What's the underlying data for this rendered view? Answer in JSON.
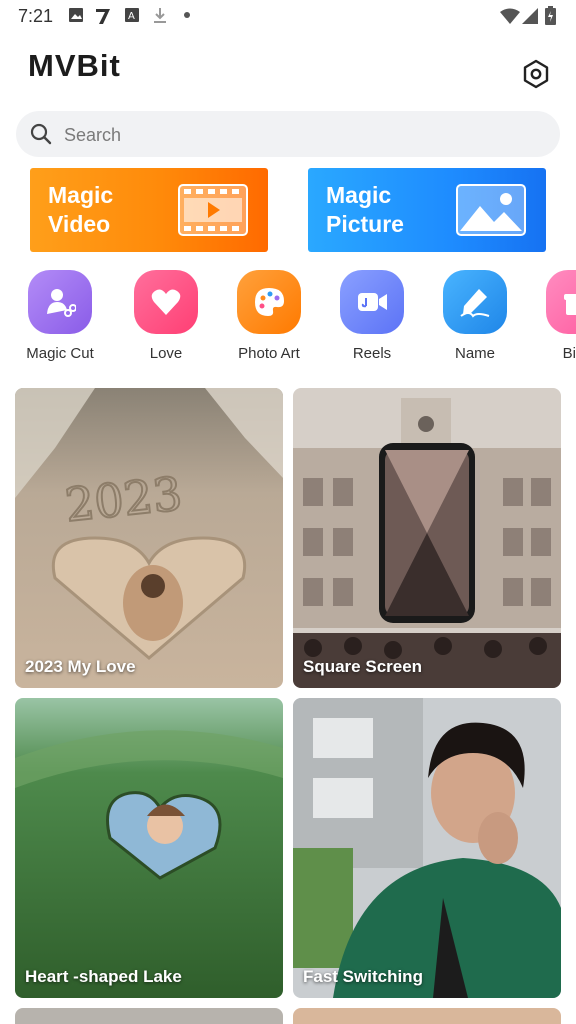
{
  "status_bar": {
    "time": "7:21"
  },
  "header": {
    "logo": "MVBit"
  },
  "search": {
    "placeholder": "Search"
  },
  "banners": [
    {
      "line1": "Magic",
      "line2": "Video"
    },
    {
      "line1": "Magic",
      "line2": "Picture"
    }
  ],
  "categories": [
    {
      "label": "Magic Cut",
      "icon": "magic-cut-icon",
      "color": "#9b6cf0"
    },
    {
      "label": "Love",
      "icon": "heart-icon",
      "color": "#ff4f86"
    },
    {
      "label": "Photo Art",
      "icon": "palette-icon",
      "color": "#ff8a1c"
    },
    {
      "label": "Reels",
      "icon": "video-camera-icon",
      "color": "#6f86ff"
    },
    {
      "label": "Name",
      "icon": "pen-icon",
      "color": "#2f9cf3"
    },
    {
      "label": "Birth",
      "icon": "gift-icon",
      "color": "#ff6fae"
    }
  ],
  "templates": [
    {
      "title": "2023 My Love"
    },
    {
      "title": "Square Screen"
    },
    {
      "title": "Heart -shaped Lake"
    },
    {
      "title": "Fast Switching"
    }
  ]
}
